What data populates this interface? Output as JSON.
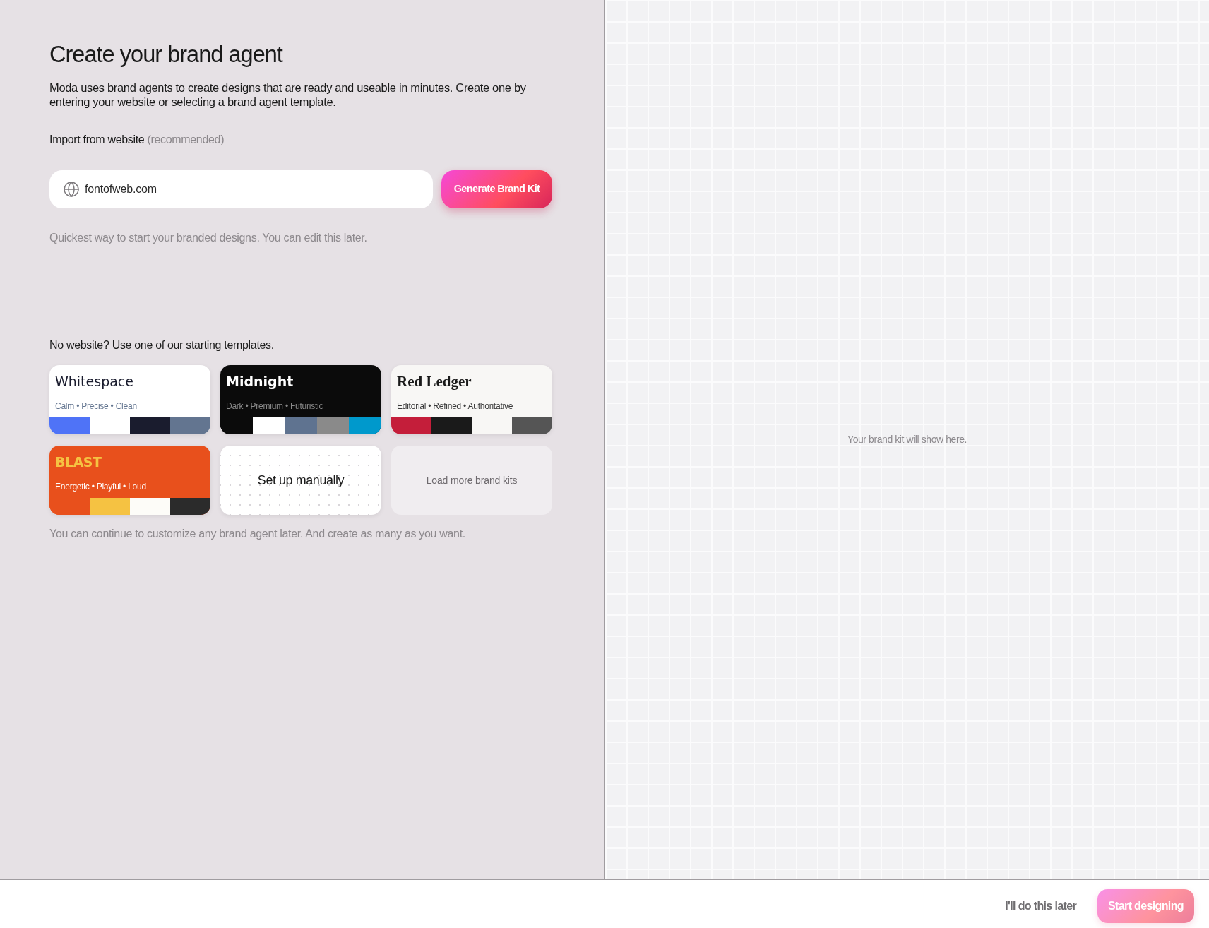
{
  "setup_panel": {
    "title": "Create your brand agent",
    "description": "Moda uses brand agents to create designs that are ready and useable in minutes. Create one by entering your website or selecting a brand agent template.",
    "import": {
      "label": "Import from website",
      "label_note": "(recommended)",
      "url_field": {
        "value": "fontofweb.com"
      },
      "button": "Generate Brand Kit",
      "hint": "Quickest way to start your branded designs. You can edit this later."
    },
    "templates": {
      "heading": "No website? Use one of our starting templates.",
      "cards": [
        {
          "kind": "template",
          "name": "Whitespace",
          "tags": "Calm • Precise • Clean",
          "color": "#ffffff",
          "swatches": [
            {
              "color": "#4f73f7"
            },
            {
              "color": "#ffffff"
            },
            {
              "color": "#1a1c2e"
            },
            {
              "color": "#637590"
            }
          ]
        },
        {
          "kind": "template",
          "name": "Midnight",
          "tags": "Dark • Premium • Futuristic",
          "color": "#0b0b0b",
          "swatches": [
            {
              "color": "#0b0b0b"
            },
            {
              "color": "#ffffff"
            },
            {
              "color": "#5f7390"
            },
            {
              "color": "#8a8a8a"
            },
            {
              "color": "#0099cc"
            }
          ]
        },
        {
          "kind": "template",
          "name": "Red Ledger",
          "tags": "Editorial • Refined • Authoritative",
          "color": "#f8f7f5",
          "swatches": [
            {
              "color": "#c41e3a"
            },
            {
              "color": "#1a1a1a"
            },
            {
              "color": "#f8f7f5"
            },
            {
              "color": "#555555"
            }
          ]
        },
        {
          "kind": "template",
          "name": "BLAST",
          "tags": "Energetic • Playful • Loud",
          "color": "#e8501c",
          "swatches": [
            {
              "color": "#e8501c"
            },
            {
              "color": "#f5c242"
            },
            {
              "color": "#fdfcf8"
            },
            {
              "color": "#2b2b2b"
            }
          ]
        },
        {
          "kind": "manual",
          "label": "Set up manually"
        },
        {
          "kind": "load_more",
          "label": "Load more brand kits"
        }
      ],
      "footnote": "You can continue to customize any brand agent later. And create as many as you want."
    }
  },
  "preview_panel": {
    "empty_message": "Your brand kit will show here."
  },
  "footer": {
    "buttons": [
      {
        "kind": "text",
        "label": "I'll do this later",
        "disabled": false
      },
      {
        "kind": "primary",
        "label": "Start designing",
        "disabled": true
      }
    ]
  }
}
